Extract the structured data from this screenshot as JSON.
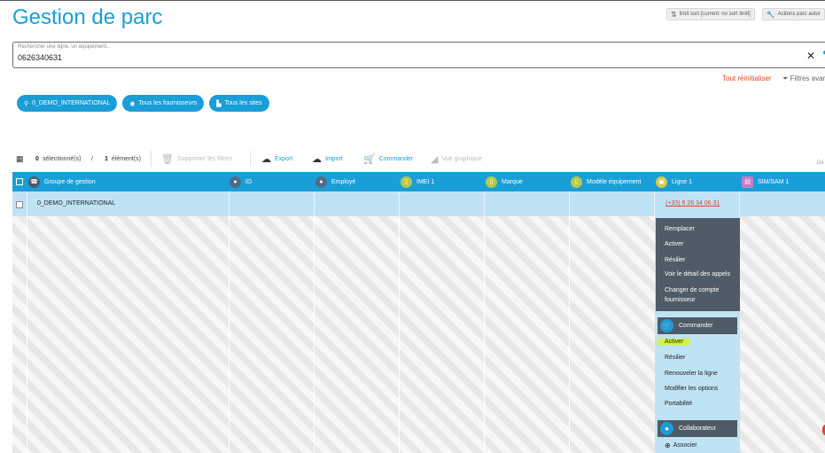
{
  "page": {
    "title": "Gestion de parc"
  },
  "top_actions": [
    {
      "label": "limit sort [current: no sort limit]",
      "icon": "sort-icon"
    },
    {
      "label": "Actions parc autor",
      "icon": "wrench-icon"
    }
  ],
  "search": {
    "label": "Rechercher une ligne, un équipement...",
    "value": "0626340631",
    "clear_icon": "✕"
  },
  "filters": {
    "reset": "Tout réinitialiser",
    "advanced": "Filtres avar"
  },
  "chips": [
    {
      "label": "0_DEMO_INTERNATIONAL",
      "icon": "org-icon"
    },
    {
      "label": "Tous les fournisseurs",
      "icon": "globe-icon"
    },
    {
      "label": "Tous les sites",
      "icon": "building-icon"
    }
  ],
  "toolbar": {
    "selected_count": "0",
    "selected_label": "sélectionné(s)",
    "separator": "/",
    "total_count": "1",
    "total_label": "élément(s)",
    "delete_filters": "Supprimer les filtres",
    "export": "Export",
    "import": "Import",
    "order": "Commander",
    "graph_view": "Vue graphique",
    "overflow": "Dé"
  },
  "columns": [
    {
      "label": "Groupe de gestion",
      "icon": "phone-icon",
      "icon_color": "#4f5b66"
    },
    {
      "label": "ID",
      "icon": "user-icon",
      "icon_color": "#4f6b86"
    },
    {
      "label": "Employé",
      "icon": "user-icon",
      "icon_color": "#4f6b86"
    },
    {
      "label": "IMEI 1",
      "icon": "mobile-icon",
      "icon_color": "#b7c94a"
    },
    {
      "label": "Marque",
      "icon": "mobile-icon",
      "icon_color": "#b7c94a"
    },
    {
      "label": "Modèle équipement",
      "icon": "mobile-icon",
      "icon_color": "#b7c94a"
    },
    {
      "label": "Ligne 1",
      "icon": "sim-icon",
      "icon_color": "#d6c94a"
    },
    {
      "label": "SIM/SAM 1",
      "icon": "sim-card-icon",
      "icon_color": "#c77dc7"
    }
  ],
  "rows": [
    {
      "group": "0_DEMO_INTERNATIONAL",
      "line": "(+33) 6 26 34 06 31"
    }
  ],
  "context_menu": {
    "line_actions": [
      "Remplacer",
      "Activer",
      "Résilier",
      "Voir le détail des appels",
      "Changer de compte",
      "fournisseur"
    ],
    "sections": [
      {
        "title": "Commander",
        "icon": "cart-icon",
        "items": [
          "Activer",
          "Résilier",
          "Renouveler la ligne",
          "Modifier les options",
          "Portabilité"
        ]
      },
      {
        "title": "Collaborateur",
        "icon": "user-icon",
        "items": [
          "Associer"
        ]
      }
    ]
  },
  "colors": {
    "accent": "#1a9ed8",
    "danger": "#e0452a",
    "menu_dark": "#4f5b66",
    "highlight": "#d6f23a",
    "row_selected": "#bfe3f4"
  }
}
